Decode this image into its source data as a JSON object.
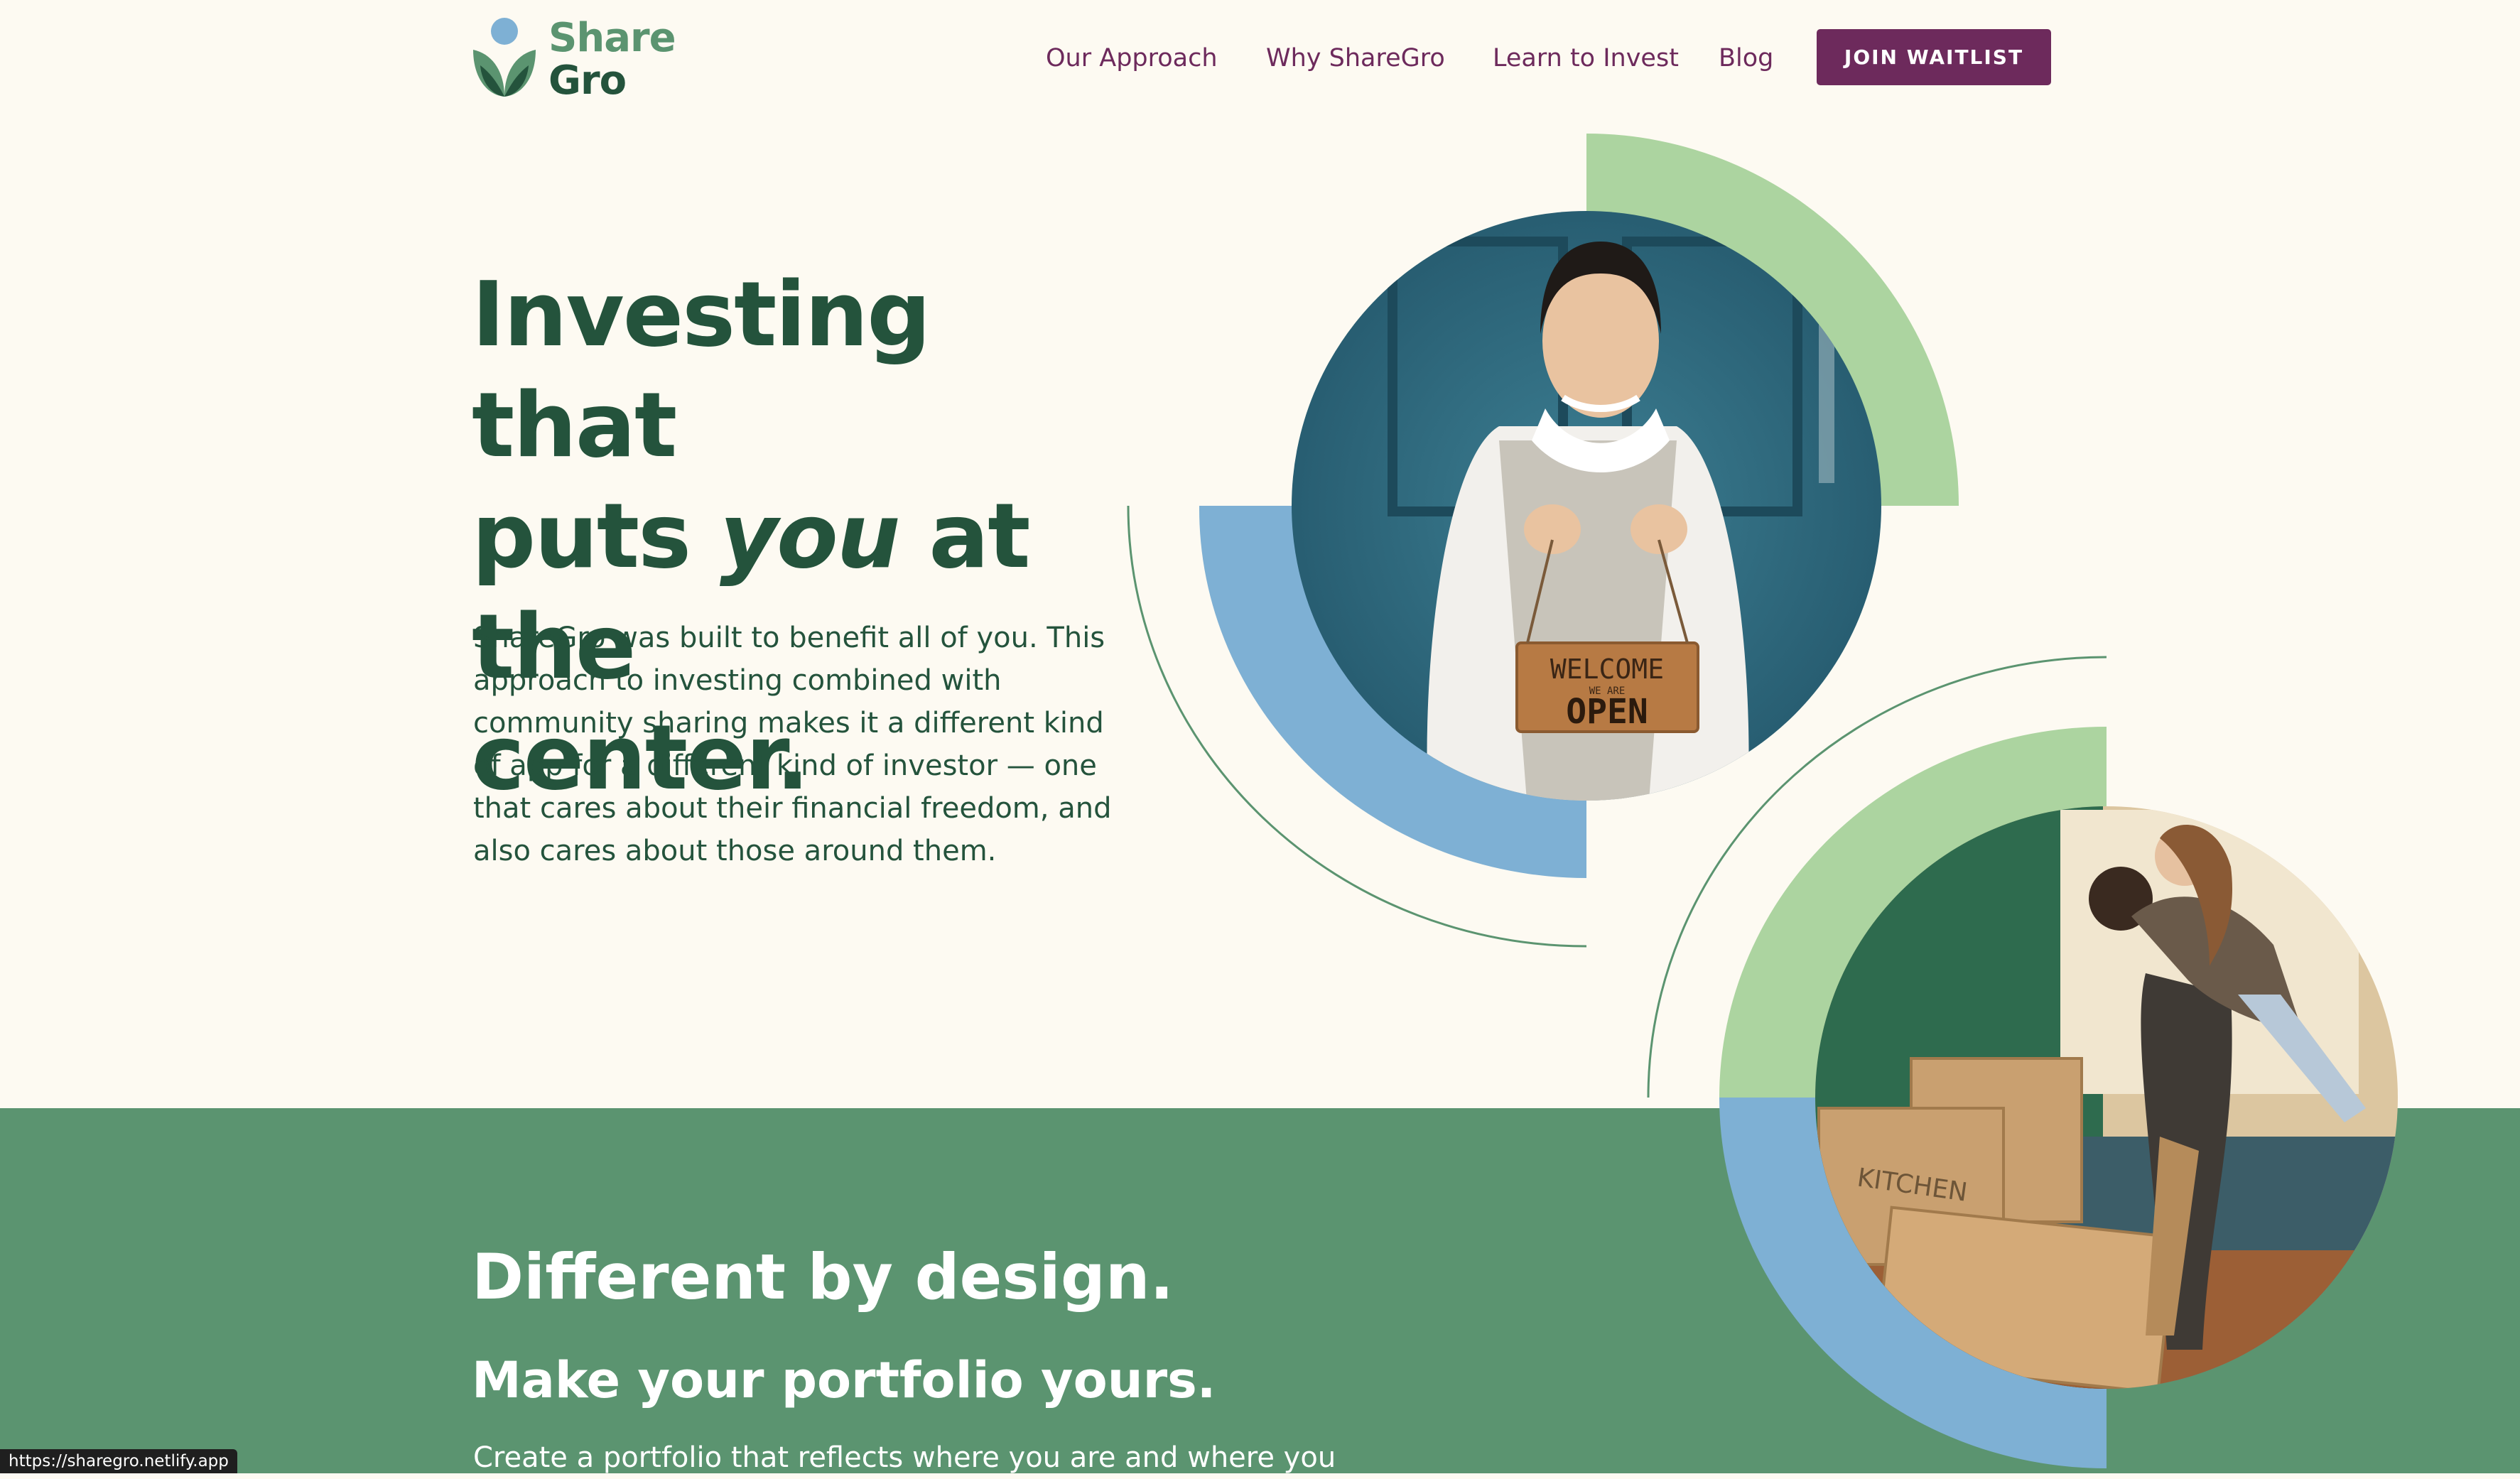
{
  "brand": {
    "name_line1": "Share",
    "name_line2": "Gro",
    "logo_icon": "sprout-logo-icon"
  },
  "nav": {
    "items": [
      {
        "label": "Our Approach"
      },
      {
        "label": "Why ShareGro"
      },
      {
        "label": "Learn to Invest"
      },
      {
        "label": "Blog"
      }
    ],
    "cta_label": "JOIN WAITLIST"
  },
  "hero": {
    "title_part1": "Investing that",
    "title_part2_pre": "puts ",
    "title_emphasis": "you",
    "title_part2_post": " at the",
    "title_part3": "center.",
    "body": "ShareGro was built to benefit all of you. This approach to investing combined with community sharing makes it a different kind of app for a different kind of investor — one that cares about their financial freedom, and also cares about those around them.",
    "photo1": {
      "sign_line1": "WELCOME",
      "sign_line2": "WE ARE",
      "sign_line3": "OPEN"
    },
    "photo2": {
      "box_label": "KITCHEN"
    }
  },
  "section2": {
    "title": "Different by design.",
    "subtitle": "Make your portfolio yours.",
    "body_partial": "Create a portfolio that reflects where you are and where you"
  },
  "status_bar": {
    "url": "https://sharegro.netlify.app"
  },
  "colors": {
    "background": "#fdfaf2",
    "brand_dark_green": "#24533c",
    "brand_green": "#5b9470",
    "light_green": "#acd4a0",
    "blue": "#7eb0d4",
    "plum": "#6d2a5c"
  }
}
